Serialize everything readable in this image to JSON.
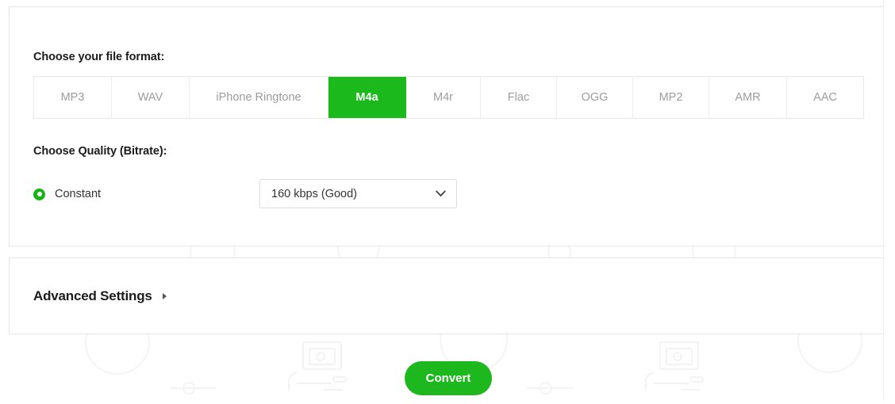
{
  "theme": {
    "accent_green": "#1bb81b",
    "panel_border": "#e6e6e6",
    "tab_text": "#9c9c9c",
    "heading_text": "#1c1c1c"
  },
  "format_section": {
    "label": "Choose your file format:",
    "tabs": [
      {
        "label": "MP3",
        "active": false
      },
      {
        "label": "WAV",
        "active": false
      },
      {
        "label": "iPhone Ringtone",
        "active": false
      },
      {
        "label": "M4a",
        "active": true
      },
      {
        "label": "M4r",
        "active": false
      },
      {
        "label": "Flac",
        "active": false
      },
      {
        "label": "OGG",
        "active": false
      },
      {
        "label": "MP2",
        "active": false
      },
      {
        "label": "AMR",
        "active": false
      },
      {
        "label": "AAC",
        "active": false
      }
    ]
  },
  "quality_section": {
    "label": "Choose Quality (Bitrate):",
    "mode": {
      "label": "Constant",
      "selected": true,
      "icon": "radio-selected-icon"
    },
    "bitrate_select": {
      "value": "160 kbps (Good)",
      "chevron_icon": "chevron-down-icon"
    }
  },
  "advanced_section": {
    "title": "Advanced Settings",
    "caret_icon": "caret-right-icon",
    "expanded": false
  },
  "actions": {
    "convert_label": "Convert"
  }
}
